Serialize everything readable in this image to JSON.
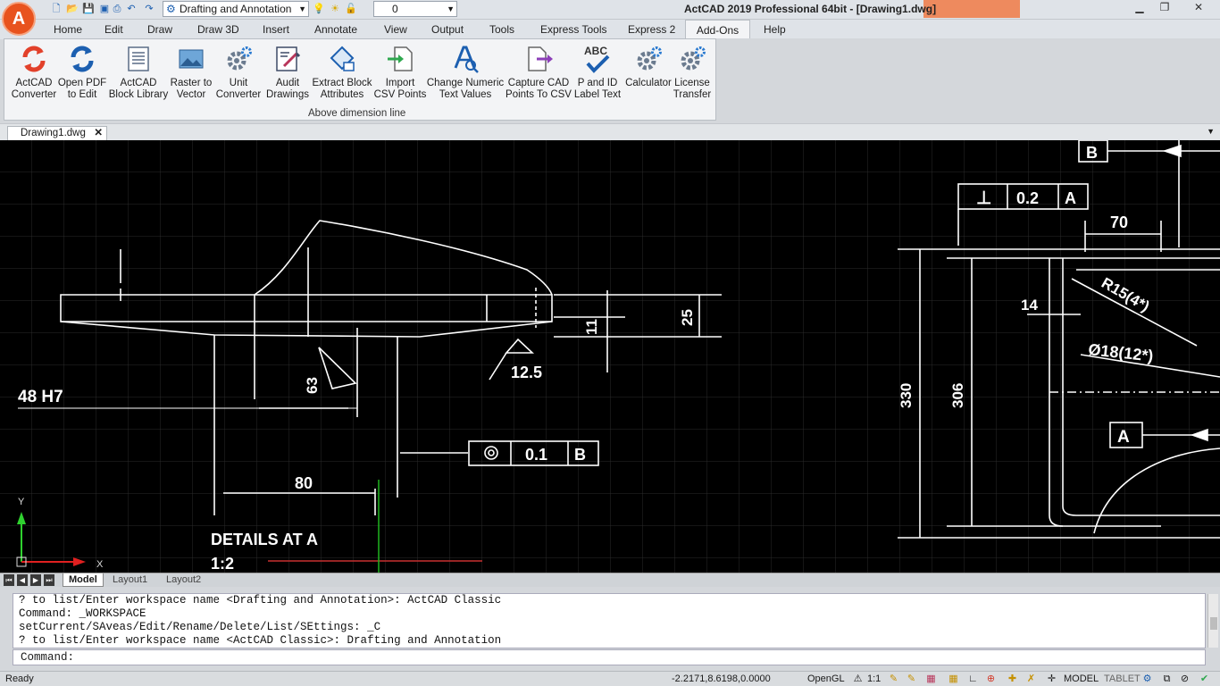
{
  "app": {
    "title": "ActCAD 2019 Professional 64bit - [Drawing1.dwg]",
    "logo": "A",
    "workspace": "Drafting and Annotation",
    "layer": "0"
  },
  "menu_tabs": [
    "Home",
    "Edit",
    "Draw",
    "Draw 3D",
    "Insert",
    "Annotate",
    "View",
    "Output",
    "Tools",
    "Express Tools",
    "Express 2",
    "Add-Ons",
    "Help"
  ],
  "active_tab": "Add-Ons",
  "ribbon": {
    "buttons": [
      {
        "l1": "ActCAD",
        "l2": "Converter",
        "icon": "converter-icon"
      },
      {
        "l1": "Open PDF",
        "l2": "to Edit",
        "icon": "open-pdf-icon"
      },
      {
        "l1": "ActCAD",
        "l2": "Block Library",
        "icon": "block-library-icon"
      },
      {
        "l1": "Raster to",
        "l2": "Vector",
        "icon": "raster-to-vector-icon"
      },
      {
        "l1": "Unit",
        "l2": "Converter",
        "icon": "gear-icon"
      },
      {
        "l1": "Audit",
        "l2": "Drawings",
        "icon": "audit-icon"
      },
      {
        "l1": "Extract Block",
        "l2": "Attributes",
        "icon": "extract-block-icon"
      },
      {
        "l1": "Import",
        "l2": "CSV Points",
        "icon": "import-csv-icon"
      },
      {
        "l1": "Change Numeric",
        "l2": "Text Values",
        "icon": "change-text-icon"
      },
      {
        "l1": "Capture CAD",
        "l2": "Points To CSV",
        "icon": "capture-points-icon"
      },
      {
        "l1": "P and ID",
        "l2": "Label Text",
        "icon": "abc-check-icon"
      },
      {
        "l1": "Calculator",
        "l2": "",
        "icon": "gear-icon"
      },
      {
        "l1": "License",
        "l2": "Transfer",
        "icon": "gear-icon"
      }
    ],
    "group_label": "Above dimension line"
  },
  "document_tab": "Drawing1.dwg",
  "drawing": {
    "labels": {
      "hole": "48 H7",
      "surface_63": "63",
      "surface_125": "12.5",
      "dim_80": "80",
      "dim_25": "25",
      "dim_11": "11",
      "tol_value": "0.1",
      "tol_datum": "B",
      "details_title": "DETAILS AT A",
      "details_scale": "1:2",
      "right_datum_b": "B",
      "perp_value": "0.2",
      "perp_datum": "A",
      "dim_70": "70",
      "dim_14": "14",
      "radius": "R15(4*)",
      "diameter": "Ø18(12*)",
      "dim_330": "330",
      "dim_306": "306",
      "datum_a": "A",
      "ucs_y": "Y",
      "ucs_x": "X"
    }
  },
  "layout_tabs": [
    "Model",
    "Layout1",
    "Layout2"
  ],
  "command": {
    "history": [
      "? to list/Enter workspace name <Drafting and Annotation>: ActCAD Classic",
      "Command: _WORKSPACE",
      "setCurrent/SAveas/Edit/Rename/Delete/List/SEttings: _C",
      "? to list/Enter workspace name <ActCAD Classic>: Drafting and Annotation"
    ],
    "prompt": "Command:"
  },
  "status": {
    "left": "Ready",
    "coords": "-2.2171,8.6198,0.0000",
    "renderer": "OpenGL",
    "scale": "1:1",
    "model": "MODEL",
    "tablet": "TABLET"
  },
  "colors": {
    "logo": "#e8531e",
    "ribbon_blue": "#1c5fb0",
    "canvas": "#000000",
    "drawing_lines": "#ffffff",
    "ucs_green": "#2fd12f",
    "ucs_red": "#e02020"
  }
}
